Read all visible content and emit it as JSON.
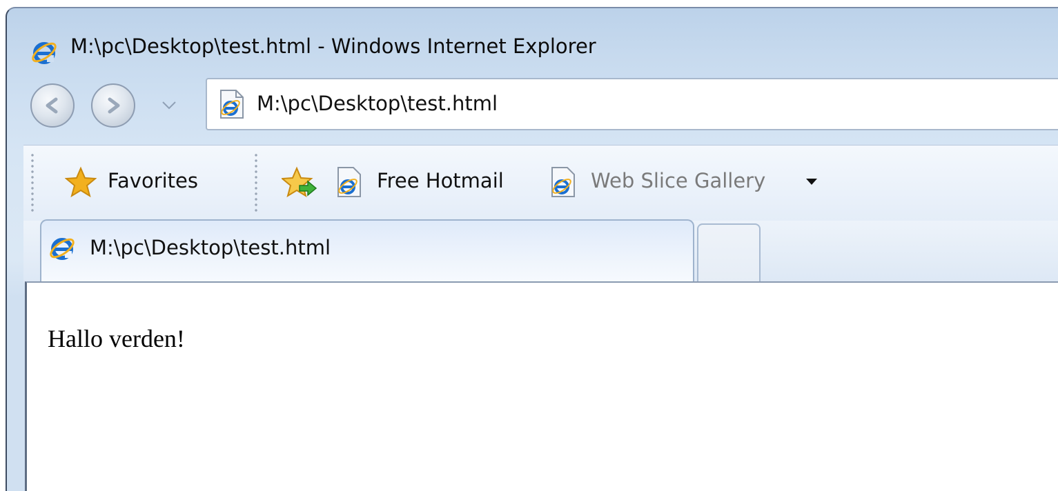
{
  "window": {
    "title": "M:\\pc\\Desktop\\test.html - Windows Internet Explorer"
  },
  "address_bar": {
    "value": "M:\\pc\\Desktop\\test.html"
  },
  "favorites_bar": {
    "favorites_label": "Favorites",
    "links": [
      {
        "label": "Free Hotmail"
      },
      {
        "label": "Web Slice Gallery"
      }
    ]
  },
  "tabs": [
    {
      "label": "M:\\pc\\Desktop\\test.html",
      "active": true
    }
  ],
  "page": {
    "text": "Hallo verden!"
  },
  "icons": {
    "ie": "ie-logo-icon",
    "back": "back-arrow-icon",
    "forward": "forward-arrow-icon",
    "star": "favorites-star-icon",
    "add_favorite": "add-favorite-icon",
    "page": "ie-page-icon",
    "dropdown": "chevron-down-icon"
  },
  "colors": {
    "chrome": "#d6e5f4",
    "ie_blue": "#1b6fd0",
    "star_gold": "#f2b01e"
  }
}
